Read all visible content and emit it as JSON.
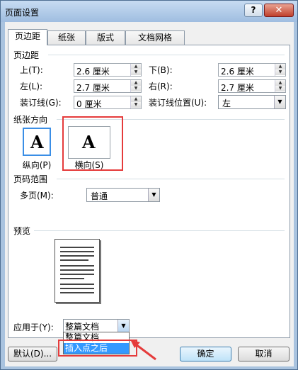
{
  "window": {
    "title": "页面设置",
    "help_label": "?",
    "close_label": "✕"
  },
  "tabs": [
    {
      "label": "页边距",
      "active": true
    },
    {
      "label": "纸张"
    },
    {
      "label": "版式"
    },
    {
      "label": "文档网格"
    }
  ],
  "margins": {
    "section_label": "页边距",
    "top": {
      "label": "上(T):",
      "value": "2.6 厘米"
    },
    "bottom": {
      "label": "下(B):",
      "value": "2.6 厘米"
    },
    "left": {
      "label": "左(L):",
      "value": "2.7 厘米"
    },
    "right": {
      "label": "右(R):",
      "value": "2.7 厘米"
    },
    "gutter": {
      "label": "装订线(G):",
      "value": "0 厘米"
    },
    "gutter_pos": {
      "label": "装订线位置(U):",
      "value": "左"
    }
  },
  "orientation": {
    "section_label": "纸张方向",
    "portrait": {
      "label": "纵向(P)",
      "glyph": "A"
    },
    "landscape": {
      "label": "横向(S)",
      "glyph": "A"
    }
  },
  "pages": {
    "section_label": "页码范围",
    "multi_label": "多页(M):",
    "value": "普通"
  },
  "preview": {
    "section_label": "预览"
  },
  "apply": {
    "label": "应用于(Y):",
    "value": "整篇文档",
    "options": [
      "整篇文档",
      "插入点之后"
    ],
    "highlighted": "插入点之后"
  },
  "footer": {
    "default_label": "默认(D)...",
    "ok_label": "确定",
    "cancel_label": "取消"
  },
  "colors": {
    "annotation": "#e53b3b",
    "selected": "#3a8ee6",
    "highlight": "#3399ff"
  }
}
